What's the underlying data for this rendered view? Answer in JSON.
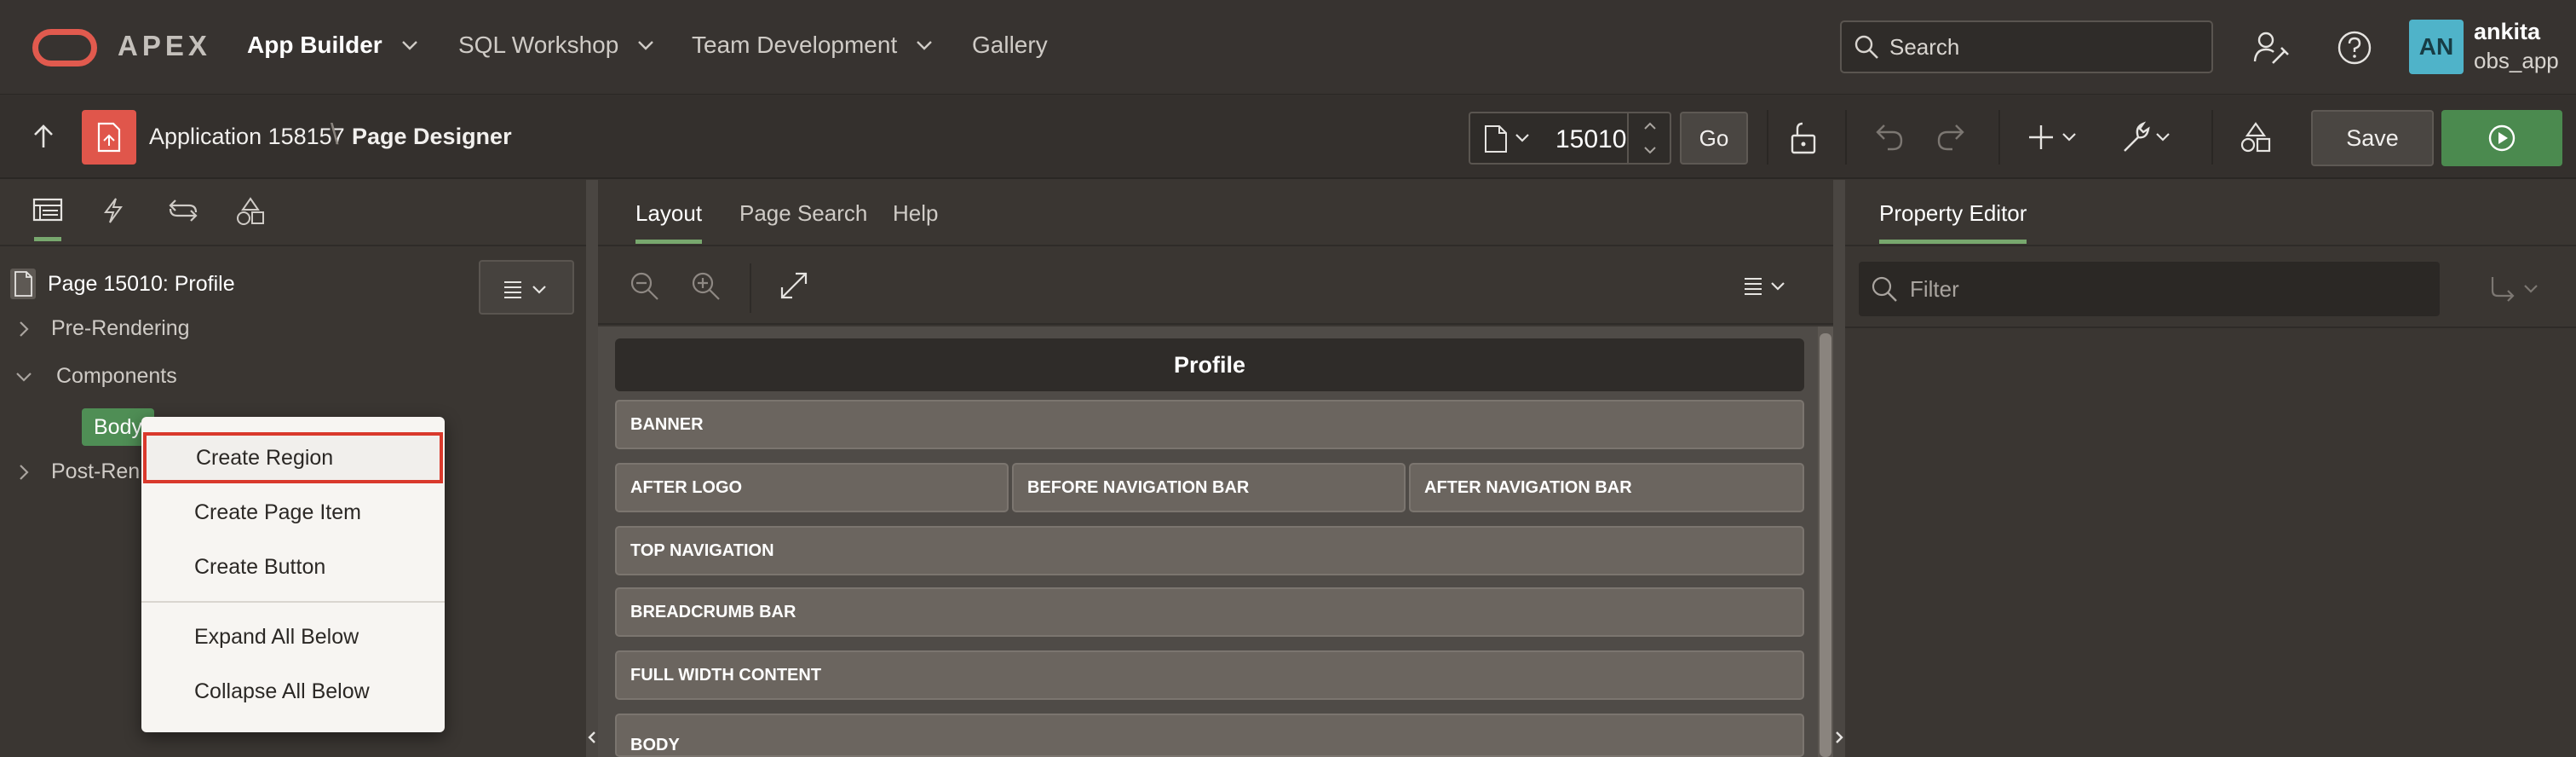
{
  "brand": {
    "name": "APEX",
    "logo_color": "#e15a4e"
  },
  "nav": {
    "items": [
      {
        "label": "App Builder",
        "active": true,
        "has_menu": true
      },
      {
        "label": "SQL Workshop",
        "active": false,
        "has_menu": true
      },
      {
        "label": "Team Development",
        "active": false,
        "has_menu": true
      },
      {
        "label": "Gallery",
        "active": false,
        "has_menu": false
      }
    ]
  },
  "search": {
    "placeholder": "Search"
  },
  "header_icons": [
    "administration-icon",
    "help-icon"
  ],
  "user": {
    "initials": "AN",
    "name": "ankita",
    "workspace": "obs_app",
    "avatar_color": "#4fb3c9"
  },
  "toolbar": {
    "app_crumb": "Application 158157",
    "separator": "\\",
    "page_crumb": "Page Designer",
    "page_number": "15010",
    "go_label": "Go",
    "save_label": "Save",
    "run_color": "#4b8a4f"
  },
  "left_pane": {
    "tabs": [
      "rendering-icon",
      "dynamic-actions-icon",
      "processing-icon",
      "shared-components-icon"
    ],
    "tree": {
      "page_label": "Page 15010: Profile",
      "rows": [
        {
          "label": "Pre-Rendering",
          "expanded": false
        },
        {
          "label": "Components",
          "expanded": true
        },
        {
          "label": "Body",
          "selected": true
        },
        {
          "label": "Post-Ren",
          "expanded": false
        }
      ]
    },
    "context_menu": {
      "items": [
        "Create Region",
        "Create Page Item",
        "Create Button",
        "Expand All Below",
        "Collapse All Below"
      ],
      "highlighted": "Create Region"
    }
  },
  "center_pane": {
    "tabs": [
      {
        "label": "Layout",
        "active": true
      },
      {
        "label": "Page Search",
        "active": false
      },
      {
        "label": "Help",
        "active": false
      }
    ],
    "grid": {
      "page_title": "Profile",
      "slots": [
        "BANNER",
        "AFTER LOGO",
        "BEFORE NAVIGATION BAR",
        "AFTER NAVIGATION BAR",
        "TOP NAVIGATION",
        "BREADCRUMB BAR",
        "FULL WIDTH CONTENT",
        "BODY"
      ]
    }
  },
  "right_pane": {
    "tab": "Property Editor",
    "filter_placeholder": "Filter"
  },
  "colors": {
    "accent_green": "#78a86e",
    "highlight_red": "#d9392c"
  }
}
